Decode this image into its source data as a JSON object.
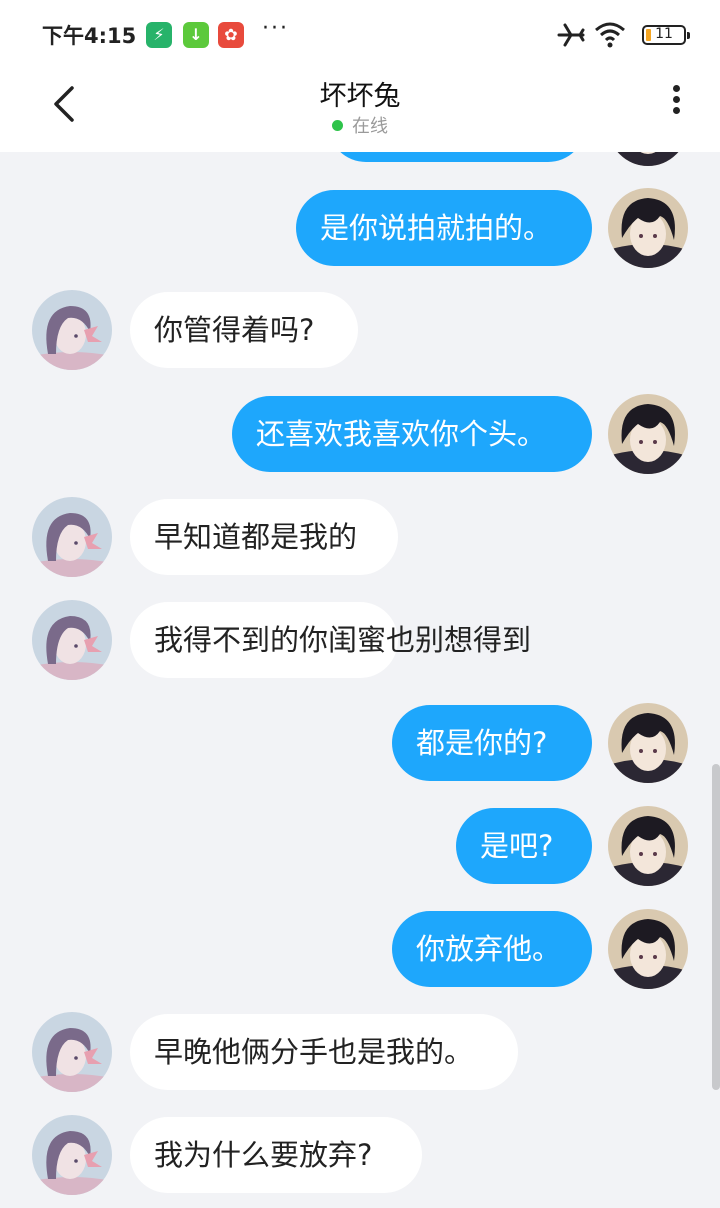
{
  "status_bar": {
    "time": "下午4:15",
    "more": "···",
    "battery": "11",
    "icons": [
      "shield-app-icon",
      "download-app-icon",
      "red-app-icon",
      "airplane-icon",
      "wifi-icon",
      "battery-icon"
    ]
  },
  "header": {
    "title": "坏坏兔",
    "presence": "在线",
    "presence_color": "#2ec34a"
  },
  "colors": {
    "outgoing_bubble": "#1ea7fc",
    "incoming_bubble": "#ffffff",
    "background": "#f2f3f6"
  },
  "messages": [
    {
      "side": "me",
      "text": "是你说拍就拍的。"
    },
    {
      "side": "them",
      "text": "你管得着吗?"
    },
    {
      "side": "me",
      "text": "还喜欢我喜欢你个头。"
    },
    {
      "side": "them",
      "text": "早知道都是我的"
    },
    {
      "side": "them",
      "text": "我得不到的你闺蜜也别想得到"
    },
    {
      "side": "me",
      "text": "都是你的?"
    },
    {
      "side": "me",
      "text": "是吧?"
    },
    {
      "side": "me",
      "text": "你放弃他。"
    },
    {
      "side": "them",
      "text": "早晚他俩分手也是我的。"
    },
    {
      "side": "them",
      "text": "我为什么要放弃?"
    }
  ]
}
